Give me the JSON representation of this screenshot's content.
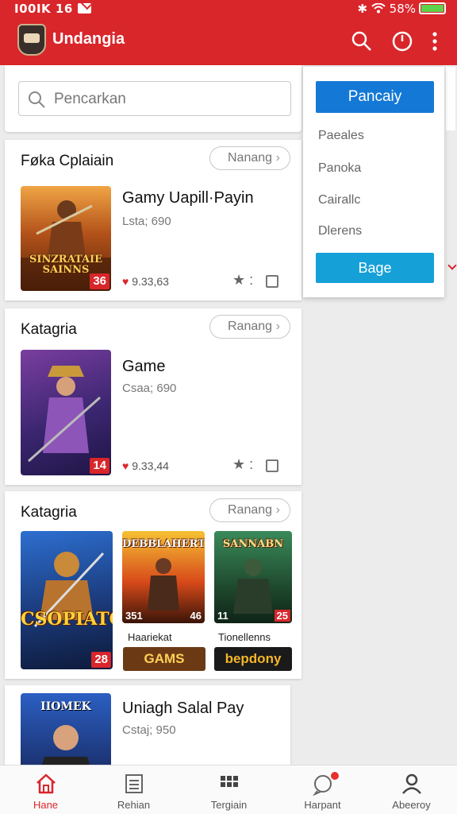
{
  "status": {
    "left_text": "I00IK 16",
    "battery": "58%",
    "battery_level": 0.58
  },
  "app": {
    "title": "Undangia"
  },
  "search": {
    "placeholder": "Pencarkan"
  },
  "sections": [
    {
      "title": "Føka Cplaiain",
      "pill": "Nanang",
      "game": {
        "title": "Gamy Uapill·Payin",
        "sub": "Lsta; 690",
        "stat": "9.33,63",
        "thumb_text": "SINZRATAIE SAINNS",
        "badge": "36"
      }
    },
    {
      "title": "Katagria",
      "pill": "Ranang",
      "game": {
        "title": "Game",
        "sub": "Csaa; 690",
        "stat": "9.33,44",
        "badge": "14"
      }
    },
    {
      "title": "Katagria",
      "pill": "Ranang",
      "tiles": [
        {
          "thumb_text": "CSOPIATC",
          "badge": "28"
        },
        {
          "top_text": "DEBBLAHERT",
          "num_left": "351",
          "num_right": "46",
          "caption": "Haariekat",
          "foot": "GAMS"
        },
        {
          "top_text": "SANNABN",
          "num_left": "11",
          "num_right": "25",
          "caption": "Tionellenns",
          "foot": "bepdony"
        }
      ]
    },
    {
      "game": {
        "title": "Uniagh Salal Pay",
        "sub": "Cstaj; 950",
        "thumb_text": "IIOMEK"
      }
    }
  ],
  "menu": {
    "primary": "Pancaiy",
    "items": [
      "Paeales",
      "Panoka",
      "Cairallc",
      "Dlerens"
    ],
    "secondary": "Bage"
  },
  "nav": [
    {
      "label": "Hane",
      "icon": "home-icon",
      "active": true
    },
    {
      "label": "Rehian",
      "icon": "list-icon"
    },
    {
      "label": "Tergiain",
      "icon": "grid-icon"
    },
    {
      "label": "Harpant",
      "icon": "chat-icon"
    },
    {
      "label": "Abeeroy",
      "icon": "profile-icon"
    }
  ],
  "colors": {
    "accent": "#d9262b",
    "primary_button": "#1479d6",
    "secondary_button": "#16a0d8"
  }
}
